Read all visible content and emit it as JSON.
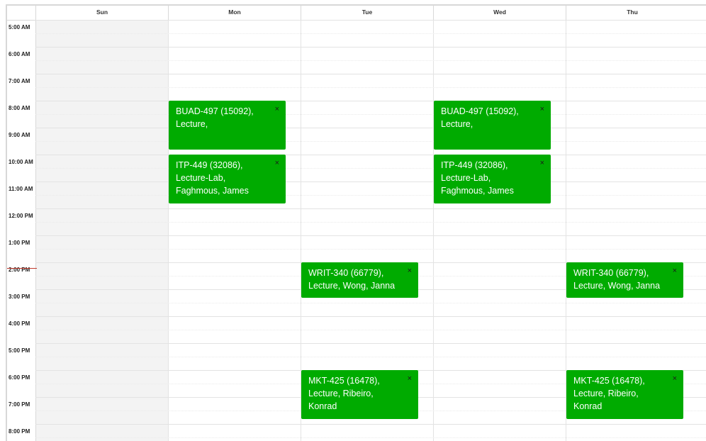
{
  "days": [
    "Sun",
    "Mon",
    "Tue",
    "Wed",
    "Thu"
  ],
  "times": [
    "5:00 AM",
    "6:00 AM",
    "7:00 AM",
    "8:00 AM",
    "9:00 AM",
    "10:00 AM",
    "11:00 AM",
    "12:00 PM",
    "1:00 PM",
    "2:00 PM",
    "3:00 PM",
    "4:00 PM",
    "5:00 PM",
    "6:00 PM",
    "7:00 PM",
    "8:00 PM"
  ],
  "close_glyph": "×",
  "colors": {
    "event": "#00ab00",
    "grid": "#e3e3e3",
    "sunday_bg": "#f3f3f3",
    "now_line": "#c0392b"
  },
  "events": [
    {
      "day": "Mon",
      "start": "8:00 AM",
      "end": "9:50 AM",
      "text": "BUAD-497 (15092),\nLecture,"
    },
    {
      "day": "Wed",
      "start": "8:00 AM",
      "end": "9:50 AM",
      "text": "BUAD-497 (15092),\nLecture,"
    },
    {
      "day": "Mon",
      "start": "10:00 AM",
      "end": "11:50 AM",
      "text": "ITP-449 (32086),\nLecture-Lab,\nFaghmous, James"
    },
    {
      "day": "Wed",
      "start": "10:00 AM",
      "end": "11:50 AM",
      "text": "ITP-449 (32086),\nLecture-Lab,\nFaghmous, James"
    },
    {
      "day": "Tue",
      "start": "2:00 PM",
      "end": "3:20 PM",
      "text": "WRIT-340 (66779),\nLecture, Wong, Janna"
    },
    {
      "day": "Thu",
      "start": "2:00 PM",
      "end": "3:20 PM",
      "text": "WRIT-340 (66779),\nLecture, Wong, Janna"
    },
    {
      "day": "Tue",
      "start": "6:00 PM",
      "end": "7:50 PM",
      "text": "MKT-425 (16478),\nLecture, Ribeiro,\nKonrad"
    },
    {
      "day": "Thu",
      "start": "6:00 PM",
      "end": "7:50 PM",
      "text": "MKT-425 (16478),\nLecture, Ribeiro,\nKonrad"
    }
  ]
}
